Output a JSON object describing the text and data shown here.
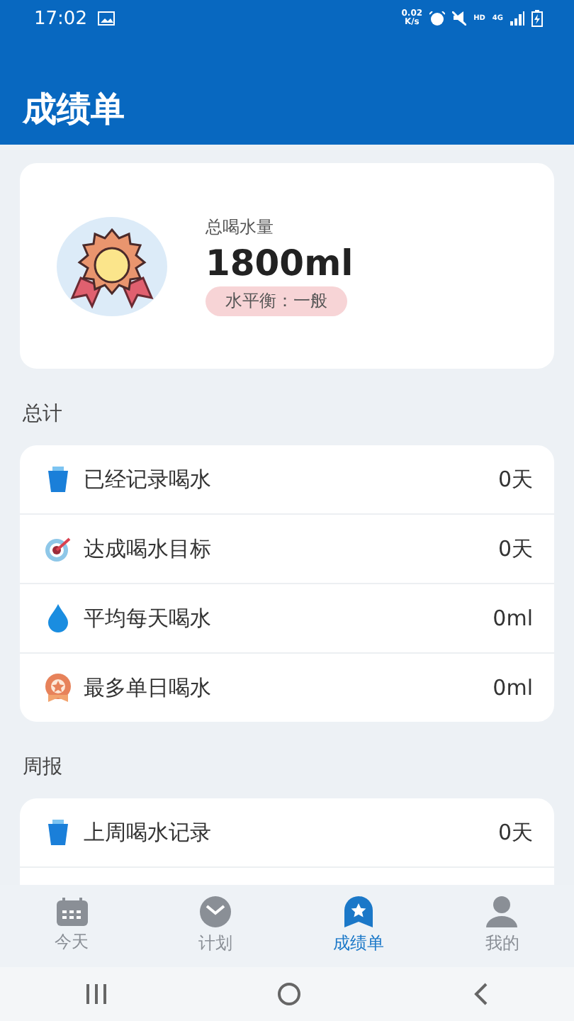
{
  "status_bar": {
    "time": "17:02",
    "speed_value": "0.02",
    "speed_unit": "K/s",
    "hd": "HD",
    "network": "4G"
  },
  "header": {
    "title": "成绩单"
  },
  "summary": {
    "label": "总喝水量",
    "value": "1800ml",
    "badge": "水平衡：一般"
  },
  "sections": [
    {
      "title": "总计",
      "rows": [
        {
          "kind": "cup",
          "label": "已经记录喝水",
          "value": "0天"
        },
        {
          "kind": "target",
          "label": "达成喝水目标",
          "value": "0天"
        },
        {
          "kind": "drop",
          "label": "平均每天喝水",
          "value": "0ml"
        },
        {
          "kind": "medal",
          "label": "最多单日喝水",
          "value": "0ml"
        }
      ]
    },
    {
      "title": "周报",
      "rows": [
        {
          "kind": "cup",
          "label": "上周喝水记录",
          "value": "0天"
        }
      ]
    }
  ],
  "tabs": [
    {
      "kind": "calendar",
      "label": "今天",
      "selected": false
    },
    {
      "kind": "clock",
      "label": "计划",
      "selected": false
    },
    {
      "kind": "badge",
      "label": "成绩单",
      "selected": true
    },
    {
      "kind": "person",
      "label": "我的",
      "selected": false
    }
  ]
}
